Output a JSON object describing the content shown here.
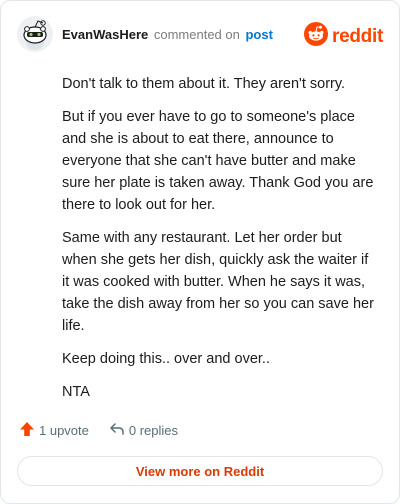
{
  "header": {
    "author": "EvanWasHere",
    "action_text": "commented on",
    "post_link": "post",
    "brand": "reddit"
  },
  "comment": {
    "paragraphs": [
      "Don't talk to them about it. They aren't sorry.",
      "But if you ever have to go to someone's place and she is about to eat there, announce to everyone that she can't have butter and make sure her plate is taken away. Thank God you are there to look out for her.",
      "Same with any restaurant. Let her order but when she gets her dish, quickly ask the waiter if it was cooked with butter. When he says it was, take the dish away from her so you can save her life.",
      "Keep doing this.. over and over..",
      "NTA"
    ]
  },
  "footer": {
    "upvotes": "1 upvote",
    "replies": "0 replies",
    "view_more": "View more on Reddit"
  },
  "colors": {
    "brand": "#ff4500",
    "link": "#0079d3",
    "view_more": "#d93a00",
    "muted": "#576f76"
  },
  "icons": {
    "avatar": "snoo-avatar-icon",
    "brand": "reddit-logo-icon",
    "upvote": "upvote-arrow-icon",
    "reply": "reply-arrow-icon"
  }
}
